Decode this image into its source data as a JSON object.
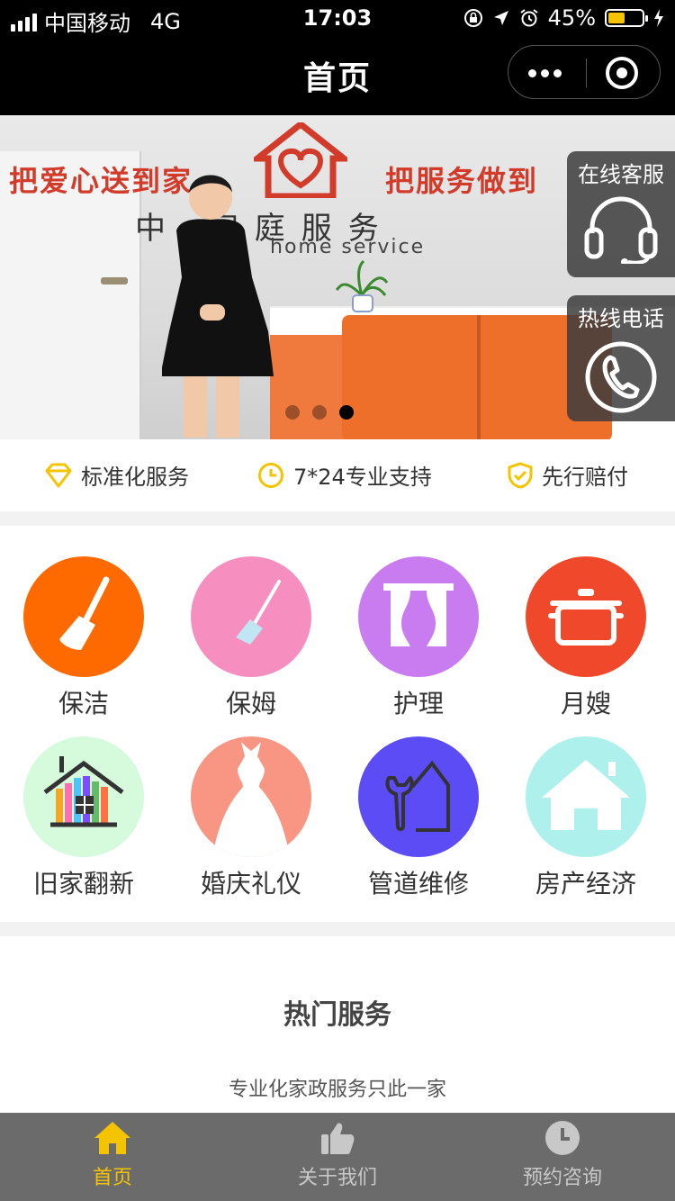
{
  "status": {
    "carrier": "中国移动",
    "network": "4G",
    "time": "17:03",
    "battery": "45%"
  },
  "navbar": {
    "title": "首页"
  },
  "banner": {
    "slogan_left": "把爱心送到家",
    "slogan_right": "把服务做到",
    "company_cn": "中  家庭服务",
    "company_en": "home service",
    "slide_count": 3,
    "active_slide": 3
  },
  "float": {
    "online_service": "在线客服",
    "hotline": "热线电话"
  },
  "features": [
    {
      "label": "标准化服务",
      "icon": "diamond-icon"
    },
    {
      "label": "7*24专业支持",
      "icon": "clock-icon"
    },
    {
      "label": "先行赔付",
      "icon": "shield-check-icon"
    }
  ],
  "categories": [
    {
      "label": "保洁",
      "color": "#ff6a00",
      "icon": "broom-icon"
    },
    {
      "label": "保姆",
      "color": "#f68fc0",
      "icon": "mop-icon"
    },
    {
      "label": "护理",
      "color": "#c97cf0",
      "icon": "curtain-icon"
    },
    {
      "label": "月嫂",
      "color": "#f0482a",
      "icon": "pot-icon"
    },
    {
      "label": "旧家翻新",
      "color": "#d6fadc",
      "icon": "colorful-house-icon"
    },
    {
      "label": "婚庆礼仪",
      "color": "#f99583",
      "icon": "wedding-dress-icon"
    },
    {
      "label": "管道维修",
      "color": "#5b4cf5",
      "icon": "wrench-house-icon"
    },
    {
      "label": "房产经济",
      "color": "#aef0ec",
      "icon": "house-icon"
    }
  ],
  "hot": {
    "title": "热门服务",
    "subtitle": "专业化家政服务只此一家"
  },
  "tabbar": [
    {
      "label": "首页",
      "icon": "home-icon",
      "active": true
    },
    {
      "label": "关于我们",
      "icon": "thumbs-up-icon",
      "active": false
    },
    {
      "label": "预约咨询",
      "icon": "clock-icon",
      "active": false
    }
  ],
  "colors": {
    "accent": "#f5c400",
    "navbar": "#000000",
    "tabbar": "#6b6b6b"
  }
}
